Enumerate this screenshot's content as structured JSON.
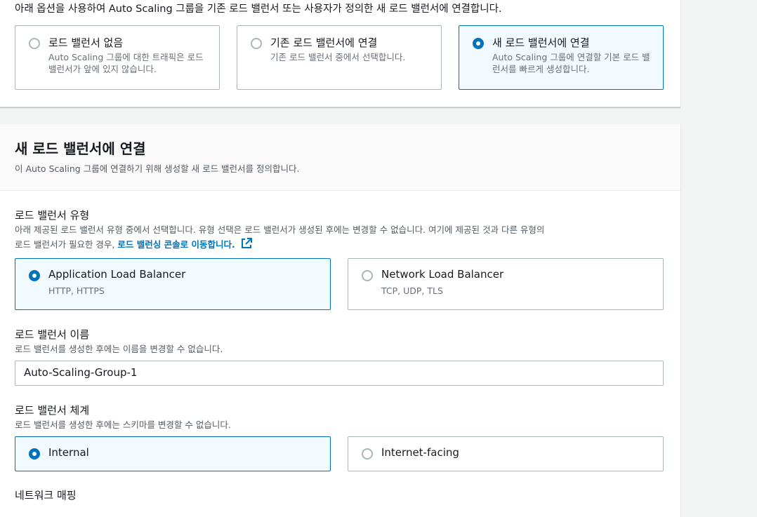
{
  "lb_options": {
    "intro": "아래 옵션을 사용하여 Auto Scaling 그룹을 기존 로드 밸런서 또는 사용자가 정의한 새 로드 밸런서에 연결합니다.",
    "items": [
      {
        "label": "로드 밸런서 없음",
        "desc": "Auto Scaling 그룹에 대한 트래픽은 로드 밸런서가 앞에 있지 않습니다.",
        "selected": false
      },
      {
        "label": "기존 로드 밸런서에 연결",
        "desc": "기존 로드 밸런서 중에서 선택합니다.",
        "selected": false
      },
      {
        "label": "새 로드 밸런서에 연결",
        "desc": "Auto Scaling 그룹에 연결할 기본 로드 밸런서를 빠르게 생성합니다.",
        "selected": true
      }
    ]
  },
  "new_lb": {
    "title": "새 로드 밸런서에 연결",
    "subtitle": "이 Auto Scaling 그룹에 연결하기 위해 생성할 새 로드 밸런서를 정의합니다.",
    "type": {
      "label": "로드 밸런서 유형",
      "desc_1": "아래 제공된 로드 밸런서 유형 중에서 선택합니다. 유형 선택은 로드 밸런서가 생성된 후에는 변경할 수 없습니다. 여기에 제공된 것과 다른 유형의",
      "desc_2": "로드 밸런서가 필요한 경우,",
      "link": "로드 밸런싱 콘솔로 이동합니다.",
      "options": [
        {
          "label": "Application Load Balancer",
          "desc": "HTTP, HTTPS",
          "selected": true
        },
        {
          "label": "Network Load Balancer",
          "desc": "TCP, UDP, TLS",
          "selected": false
        }
      ]
    },
    "name": {
      "label": "로드 밸런서 이름",
      "desc": "로드 밸런서를 생성한 후에는 이름을 변경할 수 없습니다.",
      "value": "Auto-Scaling-Group-1"
    },
    "scheme": {
      "label": "로드 밸런서 체계",
      "desc": "로드 밸런서를 생성한 후에는 스키마를 변경할 수 없습니다.",
      "options": [
        {
          "label": "Internal",
          "selected": true
        },
        {
          "label": "Internet-facing",
          "selected": false
        }
      ]
    },
    "network_mapping": {
      "label": "네트워크 매핑"
    }
  },
  "colors": {
    "accent": "#0073bb",
    "selected_bg": "#f1faff",
    "border": "#aab7b8"
  },
  "icons": {
    "external_link": "external-link-icon"
  }
}
